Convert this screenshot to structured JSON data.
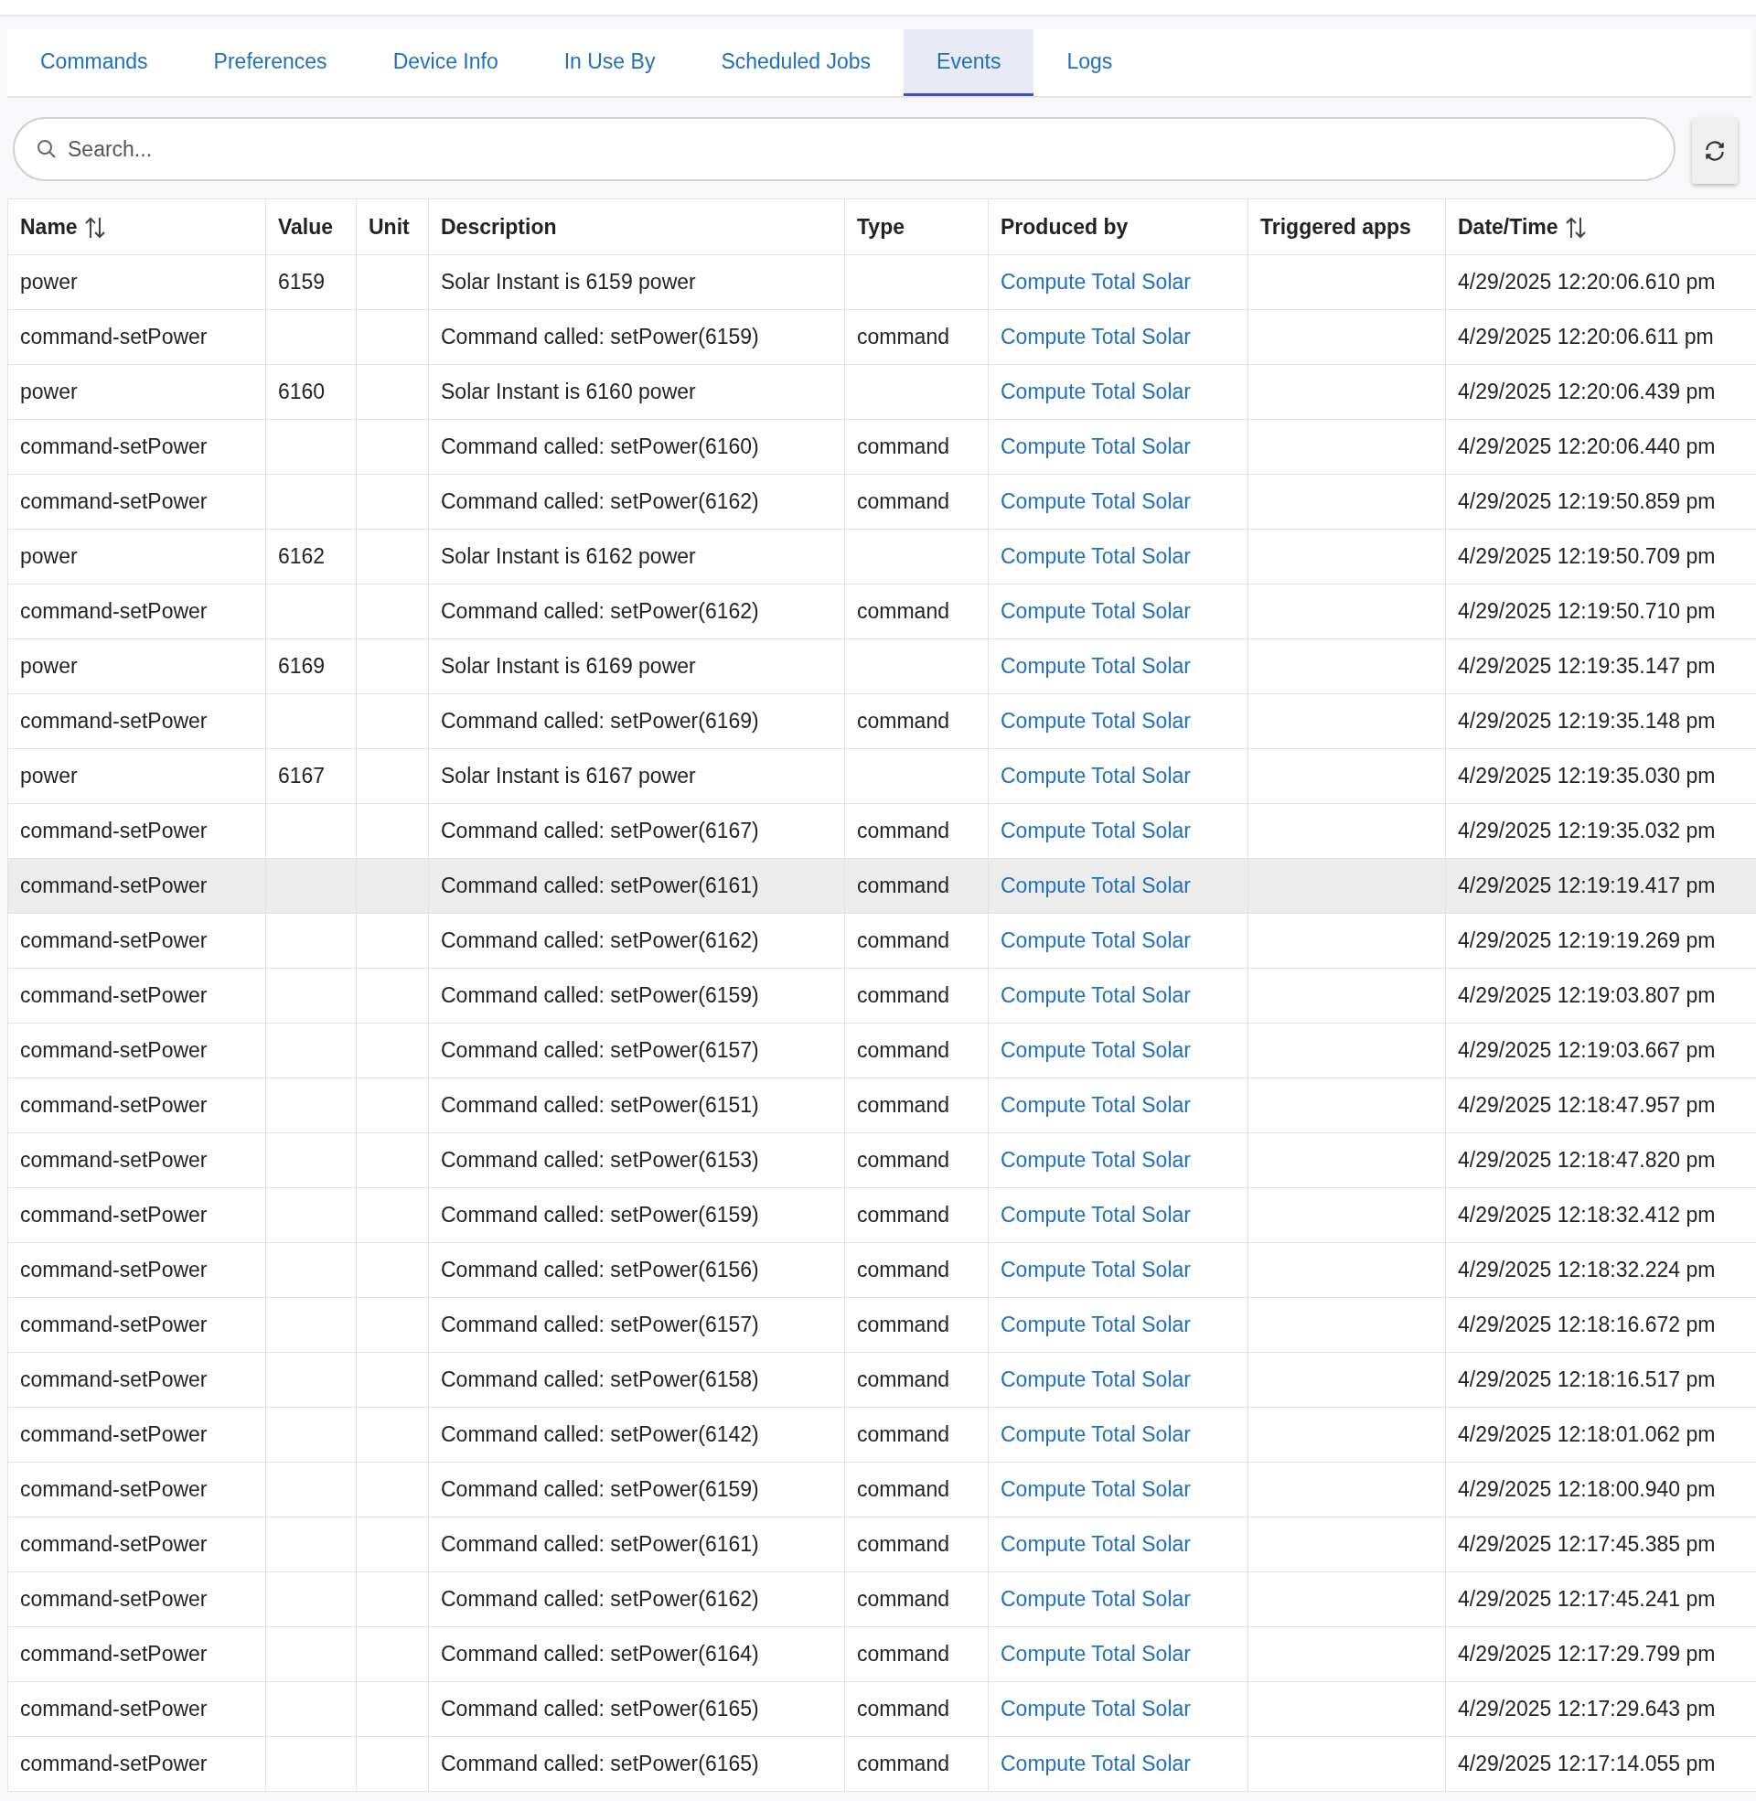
{
  "tabs": [
    {
      "label": "Commands",
      "selected": false
    },
    {
      "label": "Preferences",
      "selected": false
    },
    {
      "label": "Device Info",
      "selected": false
    },
    {
      "label": "In Use By",
      "selected": false
    },
    {
      "label": "Scheduled Jobs",
      "selected": false
    },
    {
      "label": "Events",
      "selected": true
    },
    {
      "label": "Logs",
      "selected": false
    }
  ],
  "search": {
    "placeholder": "Search..."
  },
  "table": {
    "columns": [
      {
        "label": "Name",
        "sortable": true
      },
      {
        "label": "Value",
        "sortable": false
      },
      {
        "label": "Unit",
        "sortable": false
      },
      {
        "label": "Description",
        "sortable": false
      },
      {
        "label": "Type",
        "sortable": false
      },
      {
        "label": "Produced by",
        "sortable": false
      },
      {
        "label": "Triggered apps",
        "sortable": false
      },
      {
        "label": "Date/Time",
        "sortable": true
      }
    ],
    "rows": [
      {
        "name": "power",
        "value": "6159",
        "description": "Solar Instant is 6159 power",
        "produced_by": "Compute Total Solar",
        "date_time": "4/29/2025 12:20:06.610 pm",
        "highlighted": false
      },
      {
        "name": "command-setPower",
        "description": "Command called: setPower(6159)",
        "type": "command",
        "produced_by": "Compute Total Solar",
        "date_time": "4/29/2025 12:20:06.611 pm",
        "highlighted": false
      },
      {
        "name": "power",
        "value": "6160",
        "description": "Solar Instant is 6160 power",
        "produced_by": "Compute Total Solar",
        "date_time": "4/29/2025 12:20:06.439 pm",
        "highlighted": false
      },
      {
        "name": "command-setPower",
        "description": "Command called: setPower(6160)",
        "type": "command",
        "produced_by": "Compute Total Solar",
        "date_time": "4/29/2025 12:20:06.440 pm",
        "highlighted": false
      },
      {
        "name": "command-setPower",
        "description": "Command called: setPower(6162)",
        "type": "command",
        "produced_by": "Compute Total Solar",
        "date_time": "4/29/2025 12:19:50.859 pm",
        "highlighted": false
      },
      {
        "name": "power",
        "value": "6162",
        "description": "Solar Instant is 6162 power",
        "produced_by": "Compute Total Solar",
        "date_time": "4/29/2025 12:19:50.709 pm",
        "highlighted": false
      },
      {
        "name": "command-setPower",
        "description": "Command called: setPower(6162)",
        "type": "command",
        "produced_by": "Compute Total Solar",
        "date_time": "4/29/2025 12:19:50.710 pm",
        "highlighted": false
      },
      {
        "name": "power",
        "value": "6169",
        "description": "Solar Instant is 6169 power",
        "produced_by": "Compute Total Solar",
        "date_time": "4/29/2025 12:19:35.147 pm",
        "highlighted": false
      },
      {
        "name": "command-setPower",
        "description": "Command called: setPower(6169)",
        "type": "command",
        "produced_by": "Compute Total Solar",
        "date_time": "4/29/2025 12:19:35.148 pm",
        "highlighted": false
      },
      {
        "name": "power",
        "value": "6167",
        "description": "Solar Instant is 6167 power",
        "produced_by": "Compute Total Solar",
        "date_time": "4/29/2025 12:19:35.030 pm",
        "highlighted": false
      },
      {
        "name": "command-setPower",
        "description": "Command called: setPower(6167)",
        "type": "command",
        "produced_by": "Compute Total Solar",
        "date_time": "4/29/2025 12:19:35.032 pm",
        "highlighted": false
      },
      {
        "name": "command-setPower",
        "description": "Command called: setPower(6161)",
        "type": "command",
        "produced_by": "Compute Total Solar",
        "date_time": "4/29/2025 12:19:19.417 pm",
        "highlighted": true
      },
      {
        "name": "command-setPower",
        "description": "Command called: setPower(6162)",
        "type": "command",
        "produced_by": "Compute Total Solar",
        "date_time": "4/29/2025 12:19:19.269 pm",
        "highlighted": false
      },
      {
        "name": "command-setPower",
        "description": "Command called: setPower(6159)",
        "type": "command",
        "produced_by": "Compute Total Solar",
        "date_time": "4/29/2025 12:19:03.807 pm",
        "highlighted": false
      },
      {
        "name": "command-setPower",
        "description": "Command called: setPower(6157)",
        "type": "command",
        "produced_by": "Compute Total Solar",
        "date_time": "4/29/2025 12:19:03.667 pm",
        "highlighted": false
      },
      {
        "name": "command-setPower",
        "description": "Command called: setPower(6151)",
        "type": "command",
        "produced_by": "Compute Total Solar",
        "date_time": "4/29/2025 12:18:47.957 pm",
        "highlighted": false
      },
      {
        "name": "command-setPower",
        "description": "Command called: setPower(6153)",
        "type": "command",
        "produced_by": "Compute Total Solar",
        "date_time": "4/29/2025 12:18:47.820 pm",
        "highlighted": false
      },
      {
        "name": "command-setPower",
        "description": "Command called: setPower(6159)",
        "type": "command",
        "produced_by": "Compute Total Solar",
        "date_time": "4/29/2025 12:18:32.412 pm",
        "highlighted": false
      },
      {
        "name": "command-setPower",
        "description": "Command called: setPower(6156)",
        "type": "command",
        "produced_by": "Compute Total Solar",
        "date_time": "4/29/2025 12:18:32.224 pm",
        "highlighted": false
      },
      {
        "name": "command-setPower",
        "description": "Command called: setPower(6157)",
        "type": "command",
        "produced_by": "Compute Total Solar",
        "date_time": "4/29/2025 12:18:16.672 pm",
        "highlighted": false
      },
      {
        "name": "command-setPower",
        "description": "Command called: setPower(6158)",
        "type": "command",
        "produced_by": "Compute Total Solar",
        "date_time": "4/29/2025 12:18:16.517 pm",
        "highlighted": false
      },
      {
        "name": "command-setPower",
        "description": "Command called: setPower(6142)",
        "type": "command",
        "produced_by": "Compute Total Solar",
        "date_time": "4/29/2025 12:18:01.062 pm",
        "highlighted": false
      },
      {
        "name": "command-setPower",
        "description": "Command called: setPower(6159)",
        "type": "command",
        "produced_by": "Compute Total Solar",
        "date_time": "4/29/2025 12:18:00.940 pm",
        "highlighted": false
      },
      {
        "name": "command-setPower",
        "description": "Command called: setPower(6161)",
        "type": "command",
        "produced_by": "Compute Total Solar",
        "date_time": "4/29/2025 12:17:45.385 pm",
        "highlighted": false
      },
      {
        "name": "command-setPower",
        "description": "Command called: setPower(6162)",
        "type": "command",
        "produced_by": "Compute Total Solar",
        "date_time": "4/29/2025 12:17:45.241 pm",
        "highlighted": false
      },
      {
        "name": "command-setPower",
        "description": "Command called: setPower(6164)",
        "type": "command",
        "produced_by": "Compute Total Solar",
        "date_time": "4/29/2025 12:17:29.799 pm",
        "highlighted": false
      },
      {
        "name": "command-setPower",
        "description": "Command called: setPower(6165)",
        "type": "command",
        "produced_by": "Compute Total Solar",
        "date_time": "4/29/2025 12:17:29.643 pm",
        "highlighted": false
      },
      {
        "name": "command-setPower",
        "description": "Command called: setPower(6165)",
        "type": "command",
        "produced_by": "Compute Total Solar",
        "date_time": "4/29/2025 12:17:14.055 pm",
        "highlighted": false
      }
    ]
  }
}
